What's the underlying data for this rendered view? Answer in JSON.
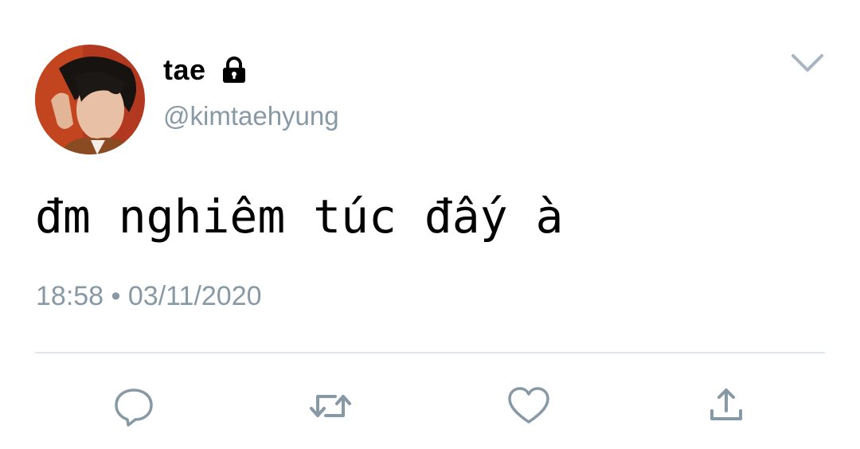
{
  "tweet": {
    "display_name": "tae",
    "handle": "@kimtaehyung",
    "text": "đm nghiêm túc đấy à",
    "timestamp": "18:58 • 03/11/2020",
    "protected_icon": "lock-icon",
    "menu_icon": "chevron-down-icon"
  },
  "actions": [
    {
      "name": "reply",
      "icon": "reply-bubble-icon"
    },
    {
      "name": "retweet",
      "icon": "retweet-icon"
    },
    {
      "name": "like",
      "icon": "heart-icon"
    },
    {
      "name": "share",
      "icon": "share-icon"
    }
  ],
  "colors": {
    "text": "#000000",
    "secondary_text": "#8899a6",
    "divider": "#e1e8ed",
    "icon": "#8899a6"
  }
}
